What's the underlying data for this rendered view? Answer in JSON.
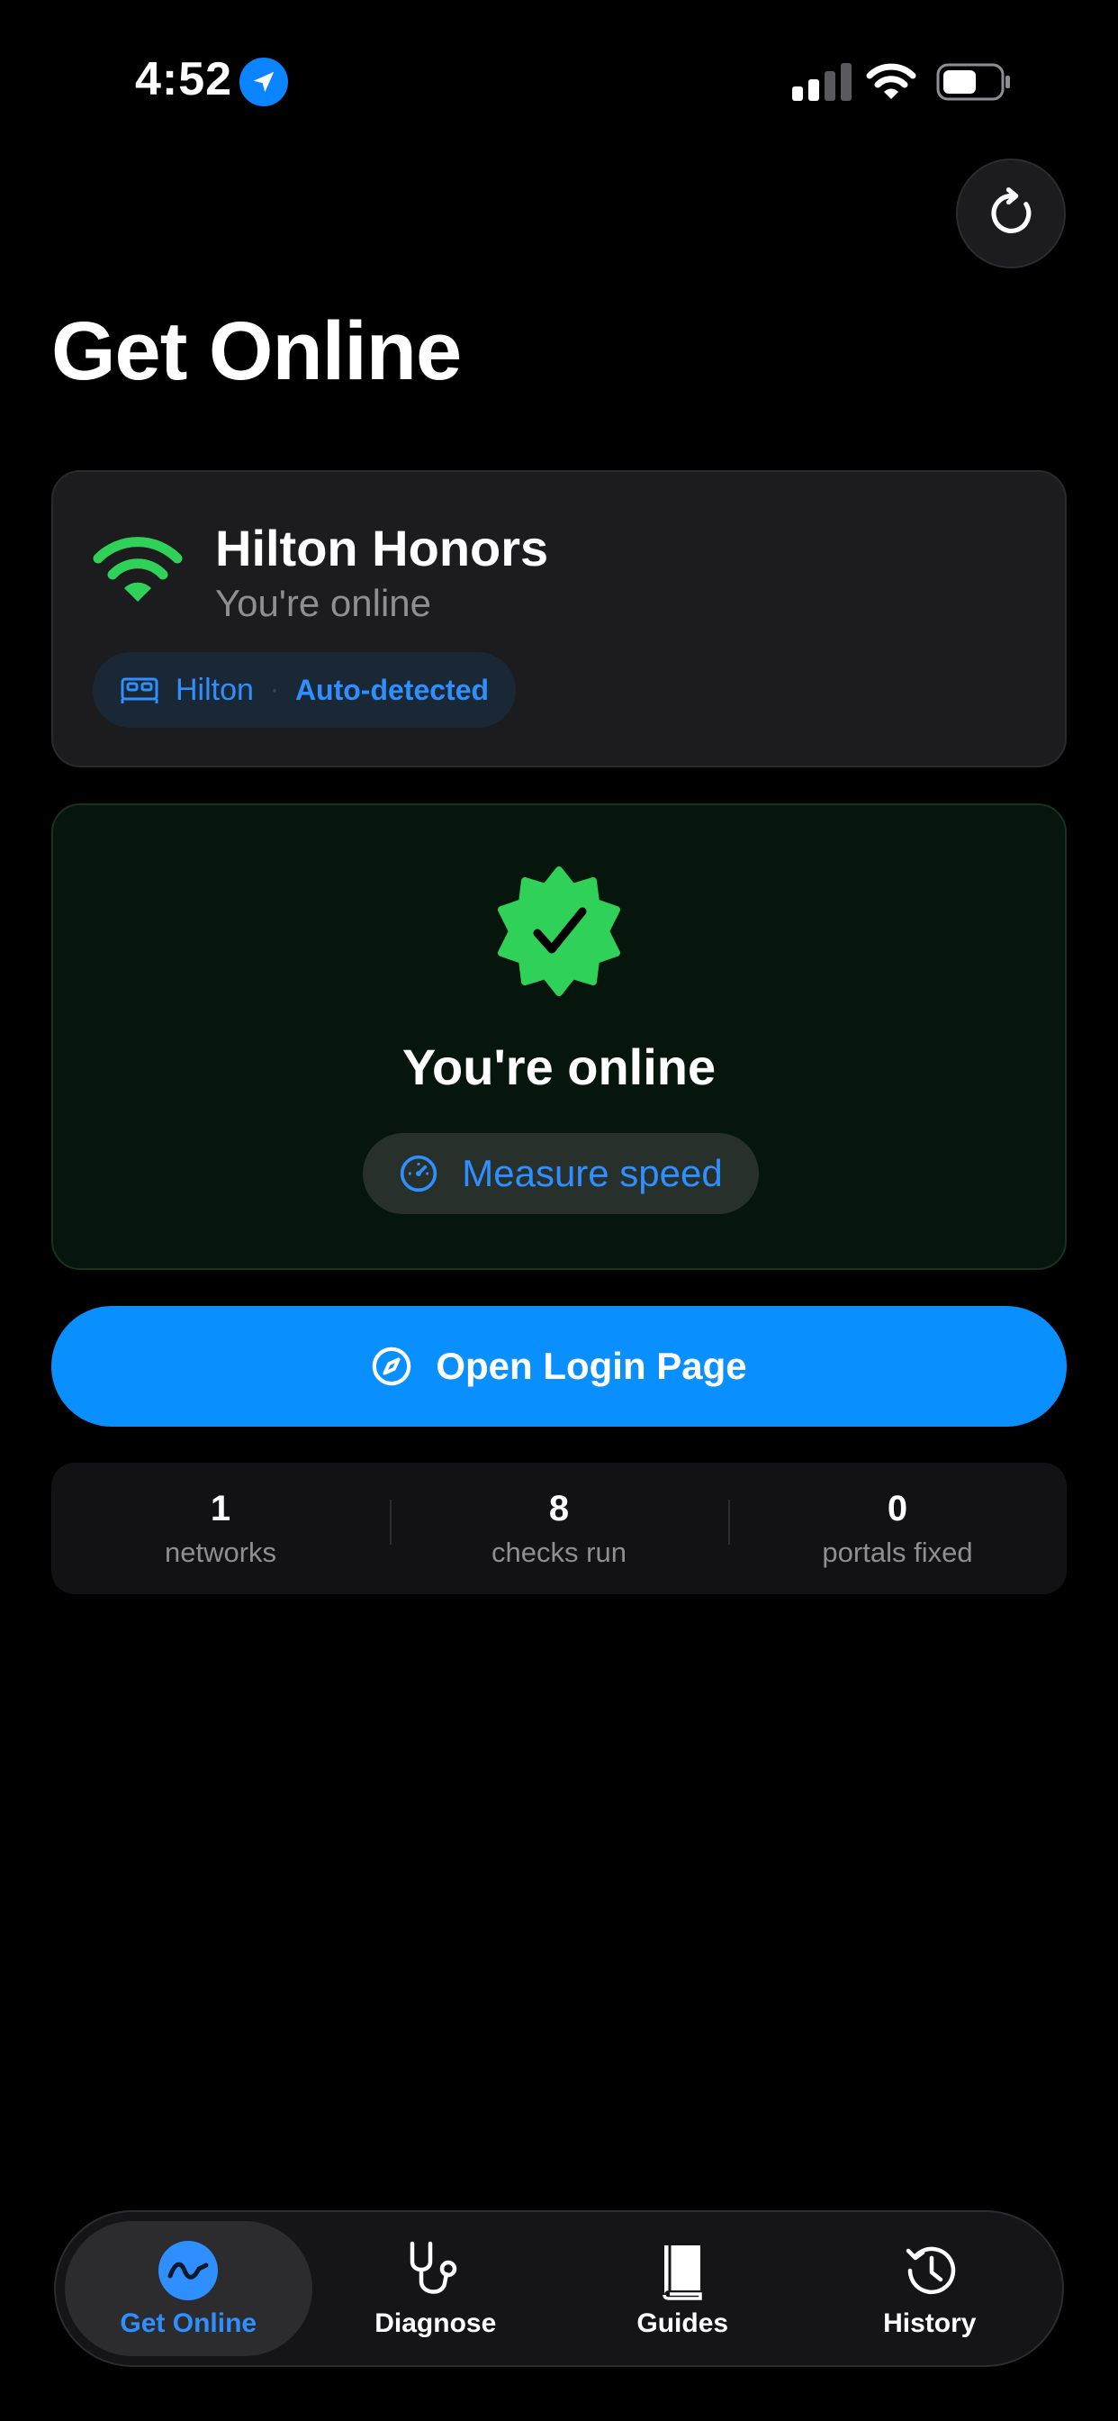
{
  "status_bar": {
    "time": "4:52"
  },
  "page": {
    "title": "Get Online"
  },
  "network": {
    "name": "Hilton Honors",
    "status": "You're online",
    "chip_brand": "Hilton",
    "chip_separator": "·",
    "chip_detection": "Auto-detected"
  },
  "online_card": {
    "message": "You're online",
    "speed_button": "Measure speed"
  },
  "login_button": "Open Login Page",
  "stats": [
    {
      "value": "1",
      "label": "networks"
    },
    {
      "value": "8",
      "label": "checks run"
    },
    {
      "value": "0",
      "label": "portals fixed"
    }
  ],
  "tabs": [
    {
      "label": "Get Online",
      "icon": "wave-icon",
      "active": true
    },
    {
      "label": "Diagnose",
      "icon": "stethoscope-icon",
      "active": false
    },
    {
      "label": "Guides",
      "icon": "book-icon",
      "active": false
    },
    {
      "label": "History",
      "icon": "history-icon",
      "active": false
    }
  ],
  "colors": {
    "accent": "#0a8fff",
    "success": "#30d158",
    "card": "#1c1c1e",
    "online_card_bg": "#07160c"
  }
}
